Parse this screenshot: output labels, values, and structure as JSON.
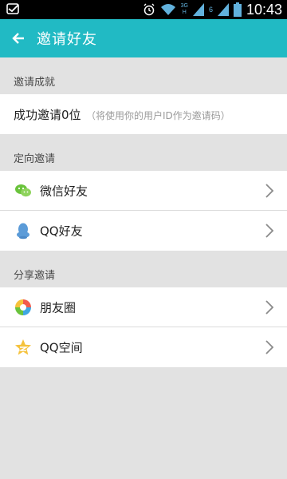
{
  "status_bar": {
    "time": "10:43",
    "net_3g": "3G",
    "net_h": "H",
    "net_6": "6",
    "icons": [
      "notification-icon",
      "alarm-icon",
      "wifi-icon",
      "signal-icon",
      "battery-icon"
    ]
  },
  "app_bar": {
    "title": "邀请好友",
    "back_icon": "back-arrow-icon",
    "color": "#21bac4"
  },
  "sections": {
    "achievement": {
      "header": "邀请成就",
      "main_text": "成功邀请0位",
      "hint_text": "（将使用你的用户ID作为邀请码）"
    },
    "directed": {
      "header": "定向邀请",
      "items": [
        {
          "label": "微信好友",
          "icon": "wechat-icon"
        },
        {
          "label": "QQ好友",
          "icon": "qq-icon"
        }
      ]
    },
    "share": {
      "header": "分享邀请",
      "items": [
        {
          "label": "朋友圈",
          "icon": "moments-icon"
        },
        {
          "label": "QQ空间",
          "icon": "qzone-icon"
        }
      ]
    }
  }
}
